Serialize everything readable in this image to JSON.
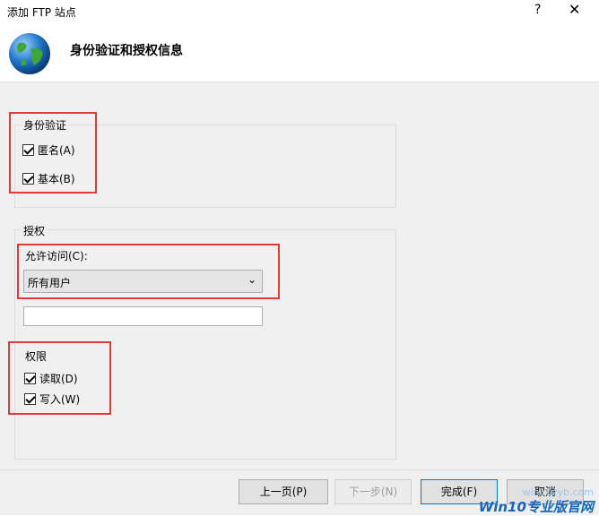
{
  "window": {
    "title": "添加 FTP 站点",
    "help_glyph": "?",
    "close_glyph": "✕"
  },
  "header": {
    "title": "身份验证和授权信息",
    "icon": "globe-icon"
  },
  "auth_group": {
    "legend": "身份验证",
    "anonymous": {
      "label": "匿名(A)",
      "checked": true
    },
    "basic": {
      "label": "基本(B)",
      "checked": true
    }
  },
  "authorization_group": {
    "legend": "授权",
    "allow_access_label": "允许访问(C):",
    "allow_access_value": "所有用户",
    "user_field_value": "",
    "permissions_legend": "权限",
    "read": {
      "label": "读取(D)",
      "checked": true
    },
    "write": {
      "label": "写入(W)",
      "checked": true
    }
  },
  "footer": {
    "prev_label": "上一页(P)",
    "next_label": "下一步(N)",
    "finish_label": "完成(F)",
    "cancel_label": "取消"
  },
  "watermark": {
    "url": "win10zyb.com",
    "brand": "Win10专业版官网"
  },
  "colors": {
    "highlight_box": "#e53935",
    "dialog_bg": "#f0f0f0"
  }
}
